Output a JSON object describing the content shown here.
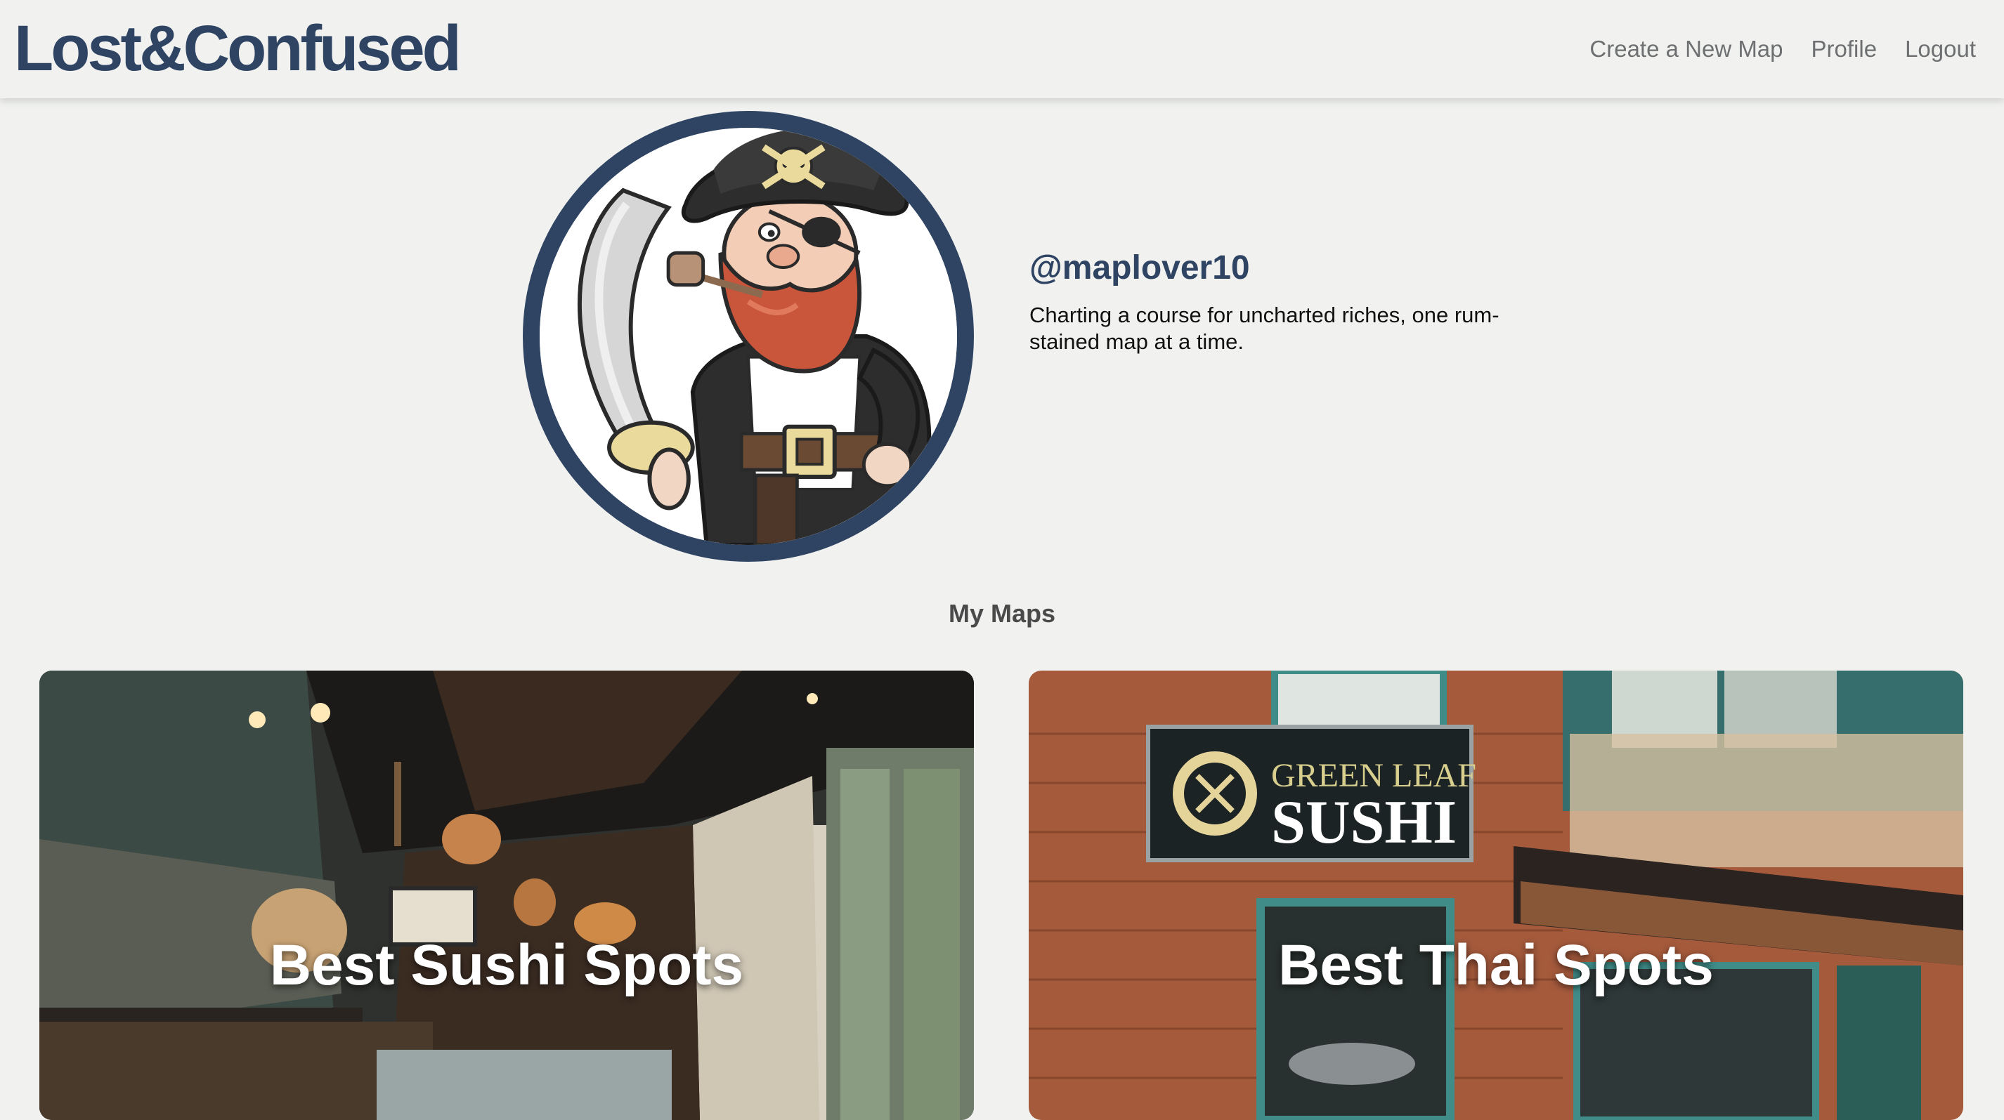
{
  "app": {
    "brand": "Lost&Confused"
  },
  "nav": {
    "links": [
      "Create a New Map",
      "Profile",
      "Logout"
    ]
  },
  "profile": {
    "username": "@maplover10",
    "bio": "Charting a course for uncharted riches, one rum-stained map at a time."
  },
  "maps": {
    "section_title": "My Maps",
    "cards": [
      {
        "title": "Best Sushi Spots"
      },
      {
        "title": "Best Thai Spots",
        "sign_text_top": "GREEN LEAF",
        "sign_text_bottom": "SUSHI"
      }
    ]
  },
  "colors": {
    "brand": "#2f4463",
    "background": "#f1f2f0",
    "nav_text": "#6d6f70"
  }
}
